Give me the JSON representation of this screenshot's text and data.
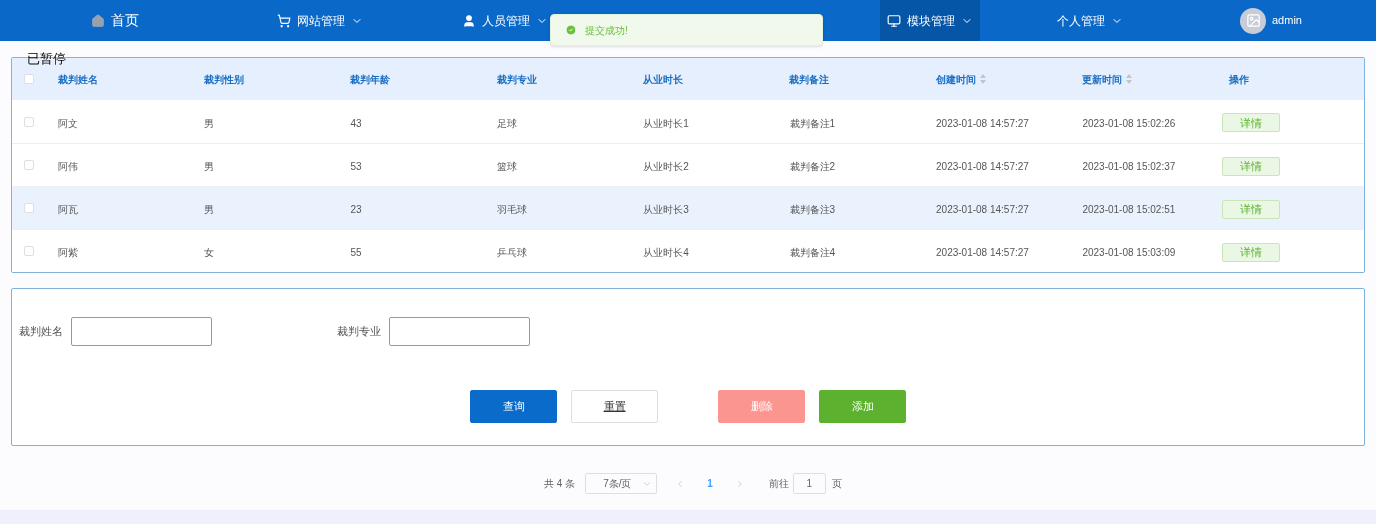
{
  "nav": {
    "items": [
      {
        "label": "首页",
        "dropdown": false,
        "selected": false
      },
      {
        "label": "网站管理",
        "dropdown": true,
        "selected": false
      },
      {
        "label": "人员管理",
        "dropdown": true,
        "selected": false
      },
      {
        "label": "模块管理",
        "dropdown": true,
        "selected": true
      },
      {
        "label": "个人管理",
        "dropdown": true,
        "selected": false
      }
    ],
    "user": {
      "name": "admin"
    }
  },
  "toast": {
    "message": "提交成功!"
  },
  "paused_label": "已暂停",
  "table": {
    "all_checked": false,
    "columns": [
      {
        "label": "裁判姓名",
        "sortable": false
      },
      {
        "label": "裁判性别",
        "sortable": false
      },
      {
        "label": "裁判年龄",
        "sortable": false
      },
      {
        "label": "裁判专业",
        "sortable": false
      },
      {
        "label": "从业时长",
        "sortable": false
      },
      {
        "label": "裁判备注",
        "sortable": false
      },
      {
        "label": "创建时间",
        "sortable": true
      },
      {
        "label": "更新时间",
        "sortable": true
      },
      {
        "label": "操作",
        "sortable": false
      }
    ],
    "rows": [
      {
        "checked": false,
        "highlighted": false,
        "cells": [
          "阿文",
          "男",
          "43",
          "足球",
          "从业时长1",
          "裁判备注1",
          "2023-01-08 14:57:27",
          "2023-01-08 15:02:26"
        ],
        "action": "详情"
      },
      {
        "checked": false,
        "highlighted": false,
        "cells": [
          "阿伟",
          "男",
          "53",
          "篮球",
          "从业时长2",
          "裁判备注2",
          "2023-01-08 14:57:27",
          "2023-01-08 15:02:37"
        ],
        "action": "详情"
      },
      {
        "checked": false,
        "highlighted": true,
        "cells": [
          "阿瓦",
          "男",
          "23",
          "羽毛球",
          "从业时长3",
          "裁判备注3",
          "2023-01-08 14:57:27",
          "2023-01-08 15:02:51"
        ],
        "action": "详情"
      },
      {
        "checked": false,
        "highlighted": false,
        "cells": [
          "阿紫",
          "女",
          "55",
          "乒乓球",
          "从业时长4",
          "裁判备注4",
          "2023-01-08 14:57:27",
          "2023-01-08 15:03:09"
        ],
        "action": "详情"
      }
    ]
  },
  "search": {
    "fields": [
      {
        "label": "裁判姓名"
      },
      {
        "label": "裁判专业"
      }
    ],
    "buttons": [
      {
        "label": "查询",
        "kind": "primary"
      },
      {
        "label": "重置",
        "kind": "plain"
      },
      {
        "label": "删除",
        "kind": "danger"
      },
      {
        "label": "添加",
        "kind": "success"
      }
    ]
  },
  "pagination": {
    "total": "共 4 条",
    "page_size": "7条/页",
    "current": "1",
    "goto_label": "前往",
    "goto_value": "1",
    "page_suffix": "页"
  }
}
